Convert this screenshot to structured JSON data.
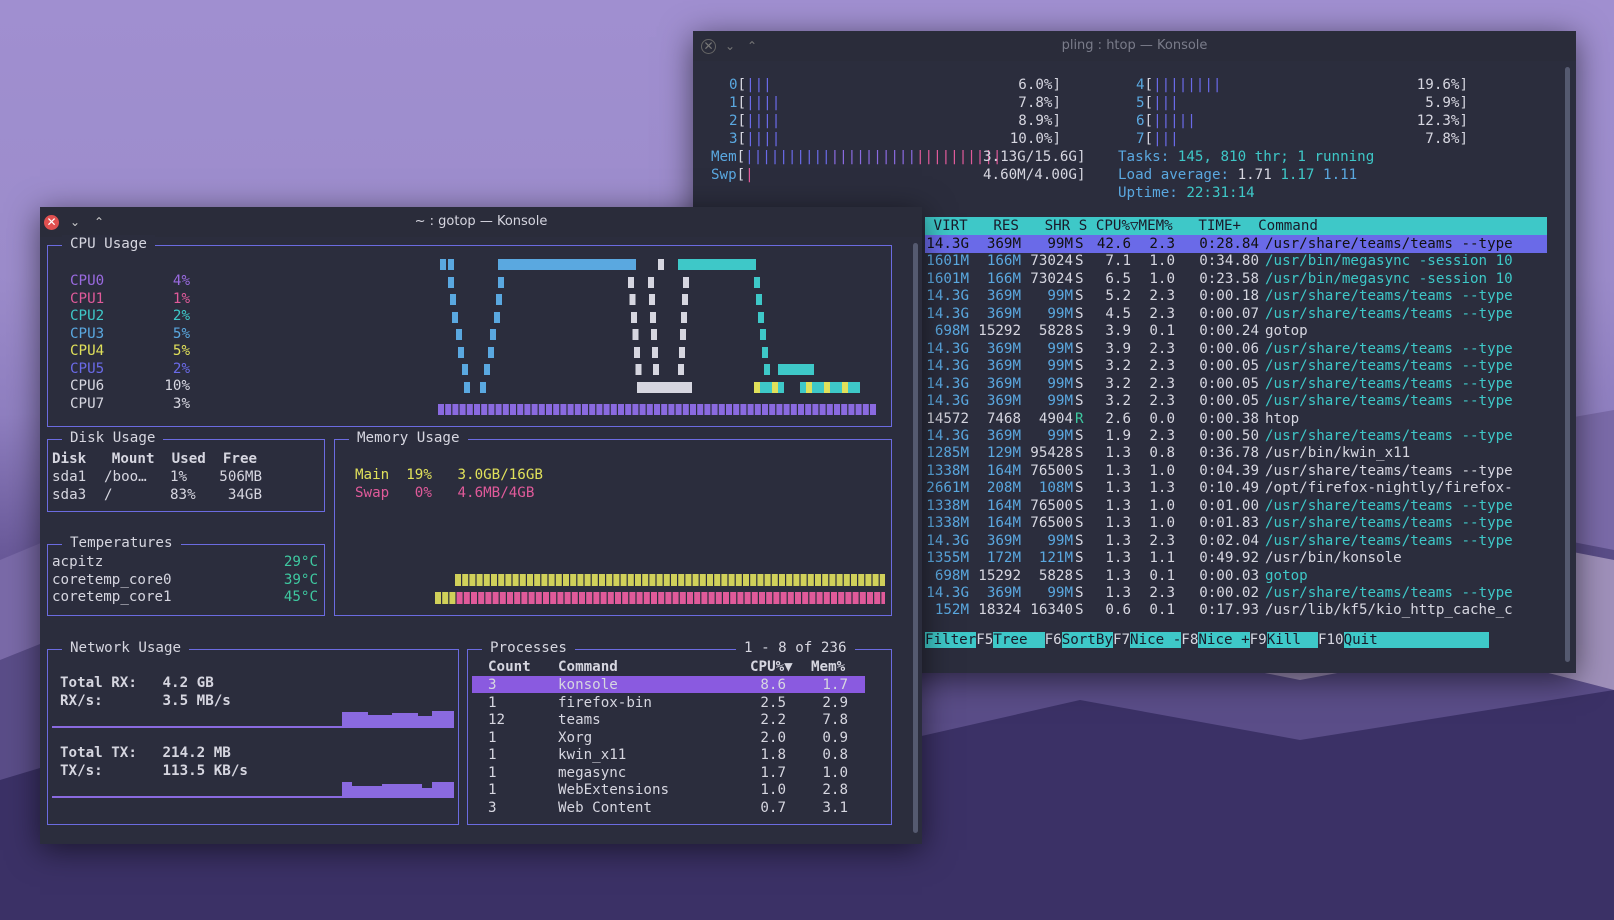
{
  "htop": {
    "title": "pling : htop — Konsole",
    "cpu_left": [
      {
        "label": "0",
        "bar": "|||",
        "pct": "6.0%"
      },
      {
        "label": "1",
        "bar": "||||",
        "pct": "7.8%"
      },
      {
        "label": "2",
        "bar": "||||",
        "pct": "8.9%"
      },
      {
        "label": "3",
        "bar": "||||",
        "pct": "10.0%"
      }
    ],
    "cpu_right": [
      {
        "label": "4",
        "bar": "||||||||",
        "pct": "19.6%"
      },
      {
        "label": "5",
        "bar": "|||",
        "pct": "5.9%"
      },
      {
        "label": "6",
        "bar": "|||||",
        "pct": "12.3%"
      },
      {
        "label": "7",
        "bar": "|||",
        "pct": "7.8%"
      }
    ],
    "mem_label": "Mem",
    "mem_bar": "||||||||||||||||||||||||||||||",
    "mem_value": "3.13G/15.6G",
    "swp_label": "Swp",
    "swp_bar": "|",
    "swp_value": "4.60M/4.00G",
    "tasks_label": "Tasks:",
    "tasks_value": "145, 810 thr; 1 running",
    "load_label": "Load average:",
    "load_1": "1.71",
    "load_5": "1.17",
    "load_15": "1.11",
    "uptime_label": "Uptime:",
    "uptime_value": "22:31:14",
    "header": " VIRT   RES   SHR S CPU%▽MEM%   TIME+  Command",
    "rows": [
      {
        "virt": "14.3G",
        "res": "369M",
        "shr": "99M",
        "s": "S",
        "cpu": "42.6",
        "mem": "2.3",
        "time": "0:28.84",
        "cmd": "/usr/share/teams/teams --type",
        "hl": true
      },
      {
        "virt": "1601M",
        "res": "166M",
        "shr": "73024",
        "s": "S",
        "cpu": "7.1",
        "mem": "1.0",
        "time": "0:34.80",
        "cmd": "/usr/bin/megasync -session 10",
        "green": true
      },
      {
        "virt": "1601M",
        "res": "166M",
        "shr": "73024",
        "s": "S",
        "cpu": "6.5",
        "mem": "1.0",
        "time": "0:23.58",
        "cmd": "/usr/bin/megasync -session 10",
        "green": true
      },
      {
        "virt": "14.3G",
        "res": "369M",
        "shr": "99M",
        "s": "S",
        "cpu": "5.2",
        "mem": "2.3",
        "time": "0:00.18",
        "cmd": "/usr/share/teams/teams --type",
        "green": true
      },
      {
        "virt": "14.3G",
        "res": "369M",
        "shr": "99M",
        "s": "S",
        "cpu": "4.5",
        "mem": "2.3",
        "time": "0:00.07",
        "cmd": "/usr/share/teams/teams --type",
        "green": true
      },
      {
        "virt": "698M",
        "res": "15292",
        "shr": "5828",
        "s": "S",
        "cpu": "3.9",
        "mem": "0.1",
        "time": "0:00.24",
        "cmd": "gotop"
      },
      {
        "virt": "14.3G",
        "res": "369M",
        "shr": "99M",
        "s": "S",
        "cpu": "3.9",
        "mem": "2.3",
        "time": "0:00.06",
        "cmd": "/usr/share/teams/teams --type",
        "green": true
      },
      {
        "virt": "14.3G",
        "res": "369M",
        "shr": "99M",
        "s": "S",
        "cpu": "3.2",
        "mem": "2.3",
        "time": "0:00.05",
        "cmd": "/usr/share/teams/teams --type",
        "green": true
      },
      {
        "virt": "14.3G",
        "res": "369M",
        "shr": "99M",
        "s": "S",
        "cpu": "3.2",
        "mem": "2.3",
        "time": "0:00.05",
        "cmd": "/usr/share/teams/teams --type",
        "green": true
      },
      {
        "virt": "14.3G",
        "res": "369M",
        "shr": "99M",
        "s": "S",
        "cpu": "3.2",
        "mem": "2.3",
        "time": "0:00.05",
        "cmd": "/usr/share/teams/teams --type",
        "green": true
      },
      {
        "virt": "14572",
        "res": "7468",
        "shr": "4904",
        "s": "R",
        "cpu": "2.6",
        "mem": "0.0",
        "time": "0:00.38",
        "cmd": "htop"
      },
      {
        "virt": "14.3G",
        "res": "369M",
        "shr": "99M",
        "s": "S",
        "cpu": "1.9",
        "mem": "2.3",
        "time": "0:00.50",
        "cmd": "/usr/share/teams/teams --type",
        "green": true
      },
      {
        "virt": "1285M",
        "res": "129M",
        "shr": "95428",
        "s": "S",
        "cpu": "1.3",
        "mem": "0.8",
        "time": "0:36.78",
        "cmd": "/usr/bin/kwin_x11"
      },
      {
        "virt": "1338M",
        "res": "164M",
        "shr": "76500",
        "s": "S",
        "cpu": "1.3",
        "mem": "1.0",
        "time": "0:04.39",
        "cmd": "/usr/share/teams/teams --type"
      },
      {
        "virt": "2661M",
        "res": "208M",
        "shr": "108M",
        "s": "S",
        "cpu": "1.3",
        "mem": "1.3",
        "time": "0:10.49",
        "cmd": "/opt/firefox-nightly/firefox-"
      },
      {
        "virt": "1338M",
        "res": "164M",
        "shr": "76500",
        "s": "S",
        "cpu": "1.3",
        "mem": "1.0",
        "time": "0:01.00",
        "cmd": "/usr/share/teams/teams --type",
        "green": true
      },
      {
        "virt": "1338M",
        "res": "164M",
        "shr": "76500",
        "s": "S",
        "cpu": "1.3",
        "mem": "1.0",
        "time": "0:01.83",
        "cmd": "/usr/share/teams/teams --type",
        "green": true
      },
      {
        "virt": "14.3G",
        "res": "369M",
        "shr": "99M",
        "s": "S",
        "cpu": "1.3",
        "mem": "2.3",
        "time": "0:02.04",
        "cmd": "/usr/share/teams/teams --type",
        "green": true
      },
      {
        "virt": "1355M",
        "res": "172M",
        "shr": "121M",
        "s": "S",
        "cpu": "1.3",
        "mem": "1.1",
        "time": "0:49.92",
        "cmd": "/usr/bin/konsole"
      },
      {
        "virt": "698M",
        "res": "15292",
        "shr": "5828",
        "s": "S",
        "cpu": "1.3",
        "mem": "0.1",
        "time": "0:00.03",
        "cmd": "gotop",
        "green": true
      },
      {
        "virt": "14.3G",
        "res": "369M",
        "shr": "99M",
        "s": "S",
        "cpu": "1.3",
        "mem": "2.3",
        "time": "0:00.02",
        "cmd": "/usr/share/teams/teams --type",
        "green": true
      },
      {
        "virt": "152M",
        "res": "18324",
        "shr": "16340",
        "s": "S",
        "cpu": "0.6",
        "mem": "0.1",
        "time": "0:17.93",
        "cmd": "/usr/lib/kf5/kio_http_cache_c"
      }
    ],
    "fkeys": [
      {
        "key": "",
        "label": "Filter"
      },
      {
        "key": "F5",
        "label": "Tree  "
      },
      {
        "key": "F6",
        "label": "SortBy"
      },
      {
        "key": "F7",
        "label": "Nice -"
      },
      {
        "key": "F8",
        "label": "Nice +"
      },
      {
        "key": "F9",
        "label": "Kill  "
      },
      {
        "key": "F10",
        "label": "Quit"
      }
    ]
  },
  "gotop": {
    "title": "~ : gotop — Konsole",
    "cpu_title": "CPU Usage",
    "cpus": [
      {
        "name": "CPU0",
        "pct": "4%",
        "color": "#9a6ae0"
      },
      {
        "name": "CPU1",
        "pct": "1%",
        "color": "#e05a9a"
      },
      {
        "name": "CPU2",
        "pct": "2%",
        "color": "#3ec8c8"
      },
      {
        "name": "CPU3",
        "pct": "5%",
        "color": "#5aa8e0"
      },
      {
        "name": "CPU4",
        "pct": "5%",
        "color": "#e0e05a"
      },
      {
        "name": "CPU5",
        "pct": "2%",
        "color": "#6a6ae8"
      },
      {
        "name": "CPU6",
        "pct": "10%",
        "color": "#d6d6e0"
      },
      {
        "name": "CPU7",
        "pct": "3%",
        "color": "#d6d6e0"
      }
    ],
    "disk_title": "Disk Usage",
    "disk_header": [
      "Disk",
      "Mount",
      "Used",
      "Free"
    ],
    "disks": [
      {
        "disk": "sda1",
        "mount": "/boo…",
        "used": "1%",
        "free": "506MB"
      },
      {
        "disk": "sda3",
        "mount": "/",
        "used": "83%",
        "free": "34GB"
      }
    ],
    "mem_title": "Memory Usage",
    "mem_main": {
      "label": "Main",
      "pct": "19%",
      "val": "3.0GB/16GB"
    },
    "mem_swap": {
      "label": "Swap",
      "pct": "0%",
      "val": "4.6MB/4GB"
    },
    "temp_title": "Temperatures",
    "temps": [
      {
        "name": "acpitz",
        "val": "29°C"
      },
      {
        "name": "coretemp_core0",
        "val": "39°C"
      },
      {
        "name": "coretemp_core1",
        "val": "45°C"
      }
    ],
    "net_title": "Network Usage",
    "net_rx_total_label": "Total RX:",
    "net_rx_total": "4.2 GB",
    "net_rx_rate_label": "RX/s:",
    "net_rx_rate": "3.5 MB/s",
    "net_tx_total_label": "Total TX:",
    "net_tx_total": "214.2 MB",
    "net_tx_rate_label": "TX/s:",
    "net_tx_rate": "113.5 KB/s",
    "proc_title": "Processes",
    "proc_count": "1 - 8 of 236",
    "proc_header": [
      "Count",
      "Command",
      "CPU%▼",
      "Mem%"
    ],
    "procs": [
      {
        "count": "3",
        "cmd": "konsole",
        "cpu": "8.6",
        "mem": "1.7",
        "sel": true
      },
      {
        "count": "1",
        "cmd": "firefox-bin",
        "cpu": "2.5",
        "mem": "2.9"
      },
      {
        "count": "12",
        "cmd": "teams",
        "cpu": "2.2",
        "mem": "7.8"
      },
      {
        "count": "1",
        "cmd": "Xorg",
        "cpu": "2.0",
        "mem": "0.9"
      },
      {
        "count": "1",
        "cmd": "kwin_x11",
        "cpu": "1.8",
        "mem": "0.8"
      },
      {
        "count": "1",
        "cmd": "megasync",
        "cpu": "1.7",
        "mem": "1.0"
      },
      {
        "count": "1",
        "cmd": "WebExtensions",
        "cpu": "1.0",
        "mem": "2.8"
      },
      {
        "count": "3",
        "cmd": "Web Content",
        "cpu": "0.7",
        "mem": "3.1"
      }
    ]
  }
}
